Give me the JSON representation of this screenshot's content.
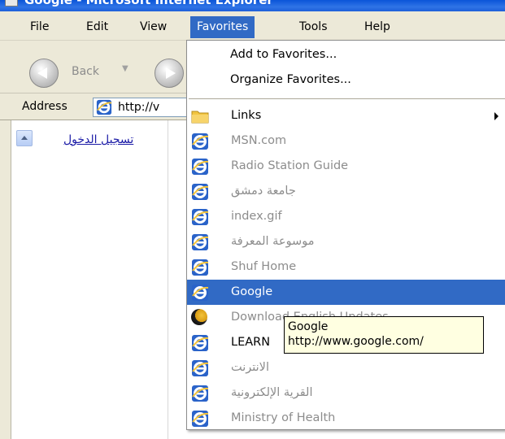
{
  "window": {
    "title": "Google - Microsoft Internet Explorer"
  },
  "menubar": {
    "items": [
      {
        "label": "File"
      },
      {
        "label": "Edit"
      },
      {
        "label": "View"
      },
      {
        "label": "Favorites"
      },
      {
        "label": "Tools"
      },
      {
        "label": "Help"
      }
    ],
    "active": "Favorites"
  },
  "toolbar": {
    "back_label": "Back",
    "back_dropdown": "▼"
  },
  "addressbar": {
    "label": "Address",
    "value": "http://v"
  },
  "page": {
    "login_link": "تسجيل الدخول"
  },
  "favorites_menu": {
    "add_label": "Add to Favorites...",
    "organize_label": "Organize Favorites...",
    "items": [
      {
        "label": "Links",
        "icon": "folder-icon",
        "submenu": true,
        "disabled": false
      },
      {
        "label": "MSN.com",
        "icon": "ie-icon",
        "disabled": true
      },
      {
        "label": "Radio Station Guide",
        "icon": "ie-icon",
        "disabled": true
      },
      {
        "label": "جامعة دمشق",
        "icon": "ie-icon",
        "disabled": true
      },
      {
        "label": "index.gif",
        "icon": "ie-icon",
        "disabled": true
      },
      {
        "label": "موسوعة المعرفة",
        "icon": "ie-icon",
        "disabled": true
      },
      {
        "label": "Shuf Home",
        "icon": "ie-icon",
        "disabled": true
      },
      {
        "label": "Google",
        "icon": "ie-icon",
        "selected": true
      },
      {
        "label": "Download English Updates",
        "icon": "moon-icon",
        "disabled": true
      },
      {
        "label": "LEARN",
        "icon": "ie-icon",
        "disabled": false
      },
      {
        "label": "الانترنت",
        "icon": "ie-icon",
        "disabled": true
      },
      {
        "label": "القرية الإلكترونية",
        "icon": "ie-icon",
        "disabled": true
      },
      {
        "label": "Ministry of Health",
        "icon": "ie-icon",
        "disabled": true
      }
    ]
  },
  "tooltip": {
    "title": "Google",
    "url": "http://www.google.com/"
  },
  "colors": {
    "selection": "#316ac5",
    "menu_bg": "#ece9d8",
    "tooltip_bg": "#ffffe1"
  }
}
